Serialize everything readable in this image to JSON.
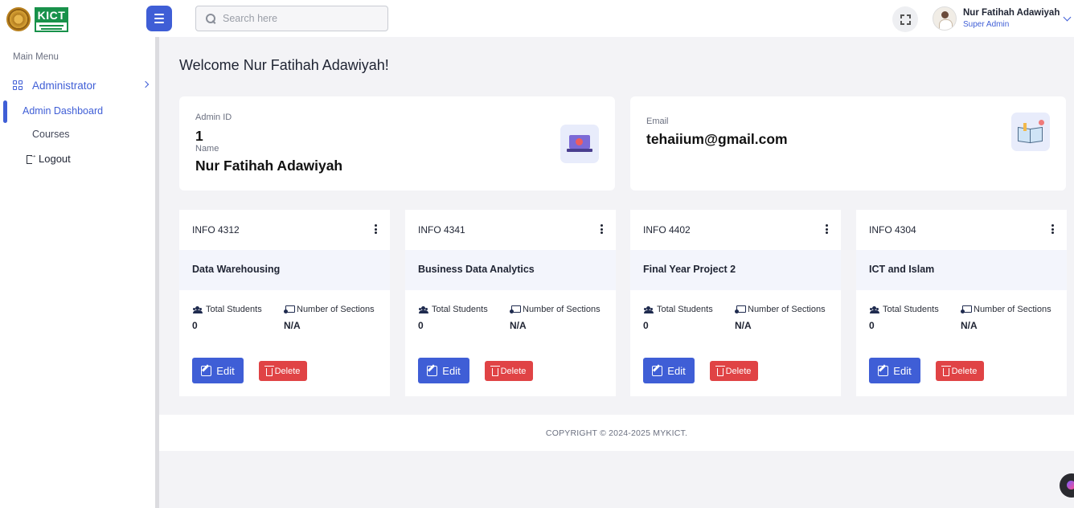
{
  "header": {
    "logo_text": "KICT",
    "menu_button": "hamburger-menu",
    "search": {
      "placeholder": "Search here",
      "value": ""
    },
    "user": {
      "name": "Nur Fatihah Adawiyah",
      "role": "Super Admin"
    }
  },
  "sidebar": {
    "section_title": "Main Menu",
    "group_label": "Administrator",
    "items": [
      {
        "label": "Admin Dashboard",
        "active": true
      },
      {
        "label": "Courses",
        "active": false
      },
      {
        "label": "Logout",
        "active": false
      }
    ]
  },
  "main": {
    "welcome": "Welcome Nur Fatihah Adawiyah!",
    "profile": {
      "id_label": "Admin ID",
      "id_value": "1",
      "name_label": "Name",
      "name_value": "Nur Fatihah Adawiyah",
      "email_label": "Email",
      "email_value": "tehaiium@gmail.com"
    },
    "stat_labels": {
      "students": "Total Students",
      "sections": "Number of Sections"
    },
    "buttons": {
      "edit": "Edit",
      "delete": "Delete"
    },
    "courses": [
      {
        "code": "INFO 4312",
        "title": "Data Warehousing",
        "students": "0",
        "sections": "N/A"
      },
      {
        "code": "INFO 4341",
        "title": "Business Data Analytics",
        "students": "0",
        "sections": "N/A"
      },
      {
        "code": "INFO 4402",
        "title": "Final Year Project 2",
        "students": "0",
        "sections": "N/A"
      },
      {
        "code": "INFO 4304",
        "title": "ICT and Islam",
        "students": "0",
        "sections": "N/A"
      }
    ]
  },
  "footer": {
    "copyright": "COPYRIGHT © 2024-2025 MYKICT."
  },
  "colors": {
    "accent": "#3f5ed6",
    "danger": "#e04345",
    "logo_green": "#18914a"
  }
}
